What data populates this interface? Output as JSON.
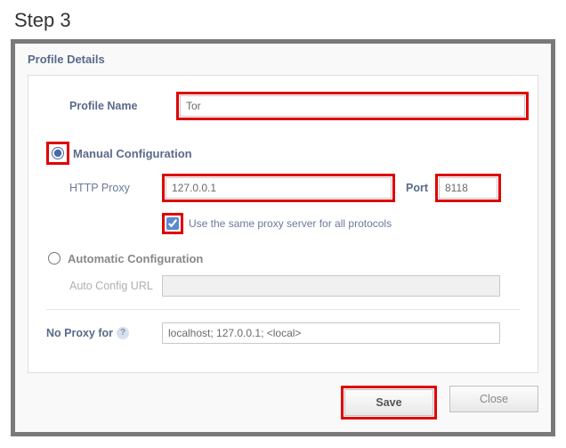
{
  "step_title": "Step 3",
  "fieldset_title": "Profile Details",
  "profile_name": {
    "label": "Profile Name",
    "value": "Tor"
  },
  "manual": {
    "label": "Manual Configuration",
    "selected": true,
    "http_proxy_label": "HTTP Proxy",
    "http_proxy_value": "127.0.0.1",
    "port_label": "Port",
    "port_value": "8118",
    "same_proxy_label": "Use the same proxy server for all protocols",
    "same_proxy_checked": true
  },
  "automatic": {
    "label": "Automatic Configuration",
    "selected": false,
    "url_label": "Auto Config URL",
    "url_value": ""
  },
  "no_proxy": {
    "label": "No Proxy for",
    "value": "localhost; 127.0.0.1; <local>"
  },
  "buttons": {
    "save": "Save",
    "close": "Close"
  }
}
